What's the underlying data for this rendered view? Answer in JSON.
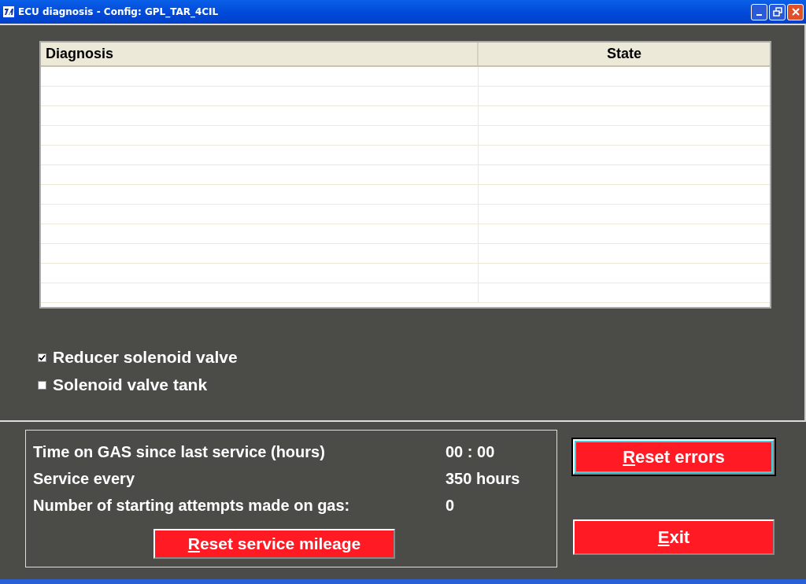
{
  "window": {
    "title": "ECU diagnosis - Config: GPL_TAR_4CIL"
  },
  "table": {
    "columns": [
      "Diagnosis",
      "State"
    ]
  },
  "checkboxes": [
    {
      "label": "Reducer solenoid valve",
      "checked": true
    },
    {
      "label": "Solenoid valve tank",
      "checked": false
    }
  ],
  "service": {
    "rows": [
      {
        "label": "Time on GAS since last service (hours)",
        "value": "00 : 00"
      },
      {
        "label": "Service every",
        "value": "350 hours"
      },
      {
        "label": "Number of starting attempts made on gas:",
        "value": "0"
      }
    ],
    "button": "Reset service mileage"
  },
  "buttons": [
    {
      "label": "Reset errors",
      "selected": true
    },
    {
      "label": "Exit",
      "selected": false
    }
  ]
}
